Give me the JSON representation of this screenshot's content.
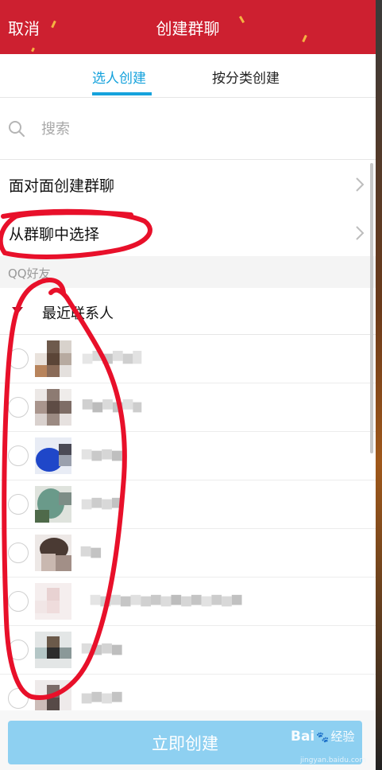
{
  "header": {
    "cancel_label": "取消",
    "title": "创建群聊"
  },
  "tabs": [
    {
      "label": "选人创建",
      "active": true
    },
    {
      "label": "按分类创建",
      "active": false
    }
  ],
  "search": {
    "placeholder": "搜索",
    "value": ""
  },
  "options": [
    {
      "label": "面对面创建群聊"
    },
    {
      "label": "从群聊中选择"
    }
  ],
  "section": {
    "label": "QQ好友"
  },
  "group": {
    "label": "最近联系人",
    "expanded": true
  },
  "footer": {
    "create_label": "立即创建"
  },
  "watermark": {
    "brand": "Bai",
    "brand_suffix": "经验",
    "site": "jingyan.baidu.com"
  },
  "colors": {
    "header_bg": "#cd2030",
    "accent": "#15a2dc",
    "button_disabled": "#8ed0f1",
    "annotation_red": "#e8102a"
  },
  "icons": {
    "search": "search-icon",
    "chevron": "chevron-right-icon",
    "expand": "triangle-down-icon"
  }
}
